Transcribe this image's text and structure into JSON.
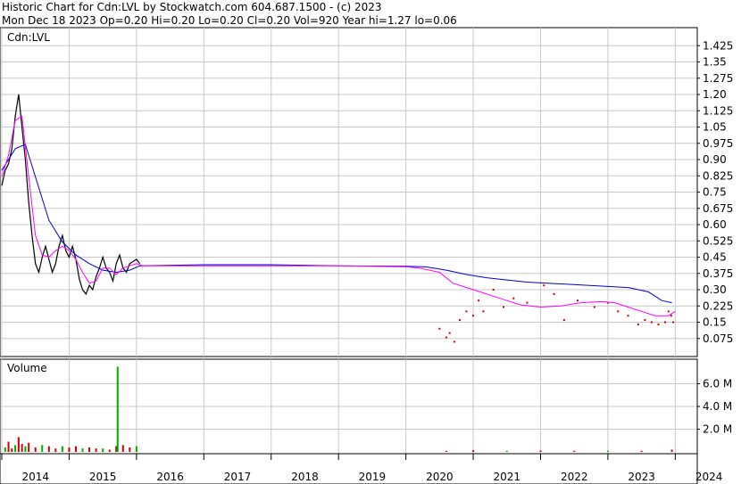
{
  "header": {
    "line1": "Historic Chart for Cdn:LVL by Stockwatch.com 604.687.1500 - (c) 2023",
    "line2": "Mon Dec 18 2023   Op=0.20  Hi=0.20  Lo=0.20  Cl=0.20  Vol=920  Year hi=1.27  lo=0.06"
  },
  "colors": {
    "grid": "#c8c8c8",
    "price_bar": "#000000",
    "ma_short": "#ff00ff",
    "ma_long": "#0000cc",
    "vol_up": "#00aa00",
    "vol_down": "#cc0000",
    "dot_color": "#cc0000"
  },
  "chart_data": [
    {
      "type": "line",
      "title": "Cdn:LVL",
      "ylim": [
        0,
        1.5
      ],
      "yticks": [
        "1.425",
        "1.35",
        "1.275",
        "1.20",
        "1.125",
        "1.05",
        "0.975",
        "0.90",
        "0.825",
        "0.75",
        "0.675",
        "0.60",
        "0.525",
        "0.45",
        "0.375",
        "0.30",
        "0.225",
        "0.15",
        "0.075"
      ],
      "ytick_values": [
        1.425,
        1.35,
        1.275,
        1.2,
        1.125,
        1.05,
        0.975,
        0.9,
        0.825,
        0.75,
        0.675,
        0.6,
        0.525,
        0.45,
        0.375,
        0.3,
        0.225,
        0.15,
        0.075
      ],
      "xlim": [
        2014.0,
        2024.3
      ],
      "xticks": [
        "2014",
        "2015",
        "2016",
        "2017",
        "2018",
        "2019",
        "2020",
        "2021",
        "2022",
        "2023",
        "2024"
      ],
      "xtick_values": [
        2014,
        2015,
        2016,
        2017,
        2018,
        2019,
        2020,
        2021,
        2022,
        2023,
        2024
      ],
      "series": [
        {
          "kind": "close",
          "x": [
            2014.0,
            2014.05,
            2014.1,
            2014.15,
            2014.2,
            2014.25,
            2014.3,
            2014.35,
            2014.4,
            2014.45,
            2014.5,
            2014.55,
            2014.6,
            2014.65,
            2014.7,
            2014.75,
            2014.8,
            2014.85,
            2014.9,
            2014.95,
            2015.0,
            2015.05,
            2015.1,
            2015.15,
            2015.2,
            2015.25,
            2015.3,
            2015.35,
            2015.4,
            2015.45,
            2015.5,
            2015.55,
            2015.6,
            2015.65,
            2015.7,
            2015.75,
            2015.8,
            2015.85,
            2015.9,
            2015.95,
            2016.0,
            2016.05
          ],
          "y": [
            0.78,
            0.85,
            0.88,
            0.95,
            1.1,
            1.2,
            1.05,
            0.9,
            0.7,
            0.55,
            0.42,
            0.38,
            0.45,
            0.5,
            0.44,
            0.38,
            0.42,
            0.5,
            0.55,
            0.48,
            0.45,
            0.5,
            0.44,
            0.35,
            0.3,
            0.28,
            0.32,
            0.3,
            0.36,
            0.4,
            0.45,
            0.4,
            0.38,
            0.34,
            0.42,
            0.46,
            0.4,
            0.38,
            0.42,
            0.43,
            0.44,
            0.42
          ]
        },
        {
          "kind": "dots",
          "x": [
            2020.5,
            2020.6,
            2020.65,
            2020.72,
            2020.8,
            2020.9,
            2021.0,
            2021.08,
            2021.15,
            2021.3,
            2021.45,
            2021.6,
            2021.8,
            2022.05,
            2022.2,
            2022.35,
            2022.55,
            2022.8,
            2023.0,
            2023.15,
            2023.3,
            2023.45,
            2023.55,
            2023.65,
            2023.75,
            2023.85,
            2023.9,
            2023.94,
            2023.97
          ],
          "y": [
            0.12,
            0.08,
            0.1,
            0.06,
            0.16,
            0.2,
            0.18,
            0.25,
            0.2,
            0.3,
            0.22,
            0.26,
            0.24,
            0.32,
            0.28,
            0.16,
            0.25,
            0.22,
            0.24,
            0.2,
            0.18,
            0.14,
            0.16,
            0.15,
            0.14,
            0.15,
            0.2,
            0.18,
            0.15
          ]
        }
      ],
      "ma_short": {
        "name": "",
        "x": [
          2014.0,
          2014.1,
          2014.2,
          2014.3,
          2014.4,
          2014.5,
          2014.6,
          2014.7,
          2014.8,
          2014.9,
          2015.0,
          2015.1,
          2015.2,
          2015.3,
          2015.4,
          2015.5,
          2015.6,
          2015.7,
          2015.8,
          2015.9,
          2016.0,
          2016.1,
          2017.0,
          2018.0,
          2019.0,
          2020.0,
          2020.2,
          2020.5,
          2020.7,
          2020.9,
          2021.1,
          2021.3,
          2021.5,
          2021.7,
          2022.0,
          2022.3,
          2022.6,
          2022.9,
          2023.1,
          2023.3,
          2023.5,
          2023.7,
          2023.9,
          2024.0
        ],
        "y": [
          0.82,
          0.92,
          1.08,
          1.1,
          0.82,
          0.55,
          0.46,
          0.45,
          0.48,
          0.5,
          0.48,
          0.44,
          0.38,
          0.33,
          0.34,
          0.4,
          0.4,
          0.37,
          0.4,
          0.41,
          0.42,
          0.41,
          0.41,
          0.41,
          0.41,
          0.405,
          0.4,
          0.38,
          0.33,
          0.31,
          0.29,
          0.27,
          0.25,
          0.23,
          0.22,
          0.225,
          0.24,
          0.245,
          0.24,
          0.22,
          0.2,
          0.18,
          0.18,
          0.2
        ]
      },
      "ma_long": {
        "name": "",
        "x": [
          2014.0,
          2014.2,
          2014.35,
          2014.5,
          2014.7,
          2014.9,
          2015.1,
          2015.3,
          2015.5,
          2015.7,
          2015.9,
          2016.05,
          2017.0,
          2018.0,
          2019.0,
          2020.0,
          2020.3,
          2020.6,
          2020.9,
          2021.2,
          2021.5,
          2021.8,
          2022.1,
          2022.4,
          2022.7,
          2023.0,
          2023.3,
          2023.6,
          2023.8,
          2023.95
        ],
        "y": [
          0.85,
          0.95,
          0.97,
          0.82,
          0.62,
          0.52,
          0.46,
          0.42,
          0.39,
          0.38,
          0.39,
          0.41,
          0.415,
          0.415,
          0.41,
          0.408,
          0.405,
          0.39,
          0.37,
          0.355,
          0.345,
          0.335,
          0.33,
          0.325,
          0.32,
          0.315,
          0.31,
          0.29,
          0.25,
          0.24
        ]
      }
    },
    {
      "type": "bar",
      "title": "Volume",
      "ylim": [
        0,
        8000000
      ],
      "yticks": [
        "6.0 M",
        "4.0 M",
        "2.0 M"
      ],
      "ytick_values": [
        6000000,
        4000000,
        2000000
      ],
      "series": [
        {
          "name": "",
          "x": [
            2014.05,
            2014.1,
            2014.15,
            2014.2,
            2014.25,
            2014.3,
            2014.35,
            2014.4,
            2014.5,
            2014.6,
            2014.7,
            2014.8,
            2014.9,
            2015.0,
            2015.1,
            2015.2,
            2015.3,
            2015.4,
            2015.5,
            2015.6,
            2015.7,
            2015.72,
            2015.8,
            2015.9,
            2016.0,
            2020.6,
            2021.0,
            2021.5,
            2022.0,
            2022.5,
            2023.0,
            2023.5,
            2023.95
          ],
          "values": [
            400000,
            900000,
            300000,
            600000,
            1300000,
            700000,
            500000,
            800000,
            400000,
            600000,
            500000,
            300000,
            500000,
            400000,
            500000,
            300000,
            400000,
            300000,
            300000,
            200000,
            500000,
            7500000,
            600000,
            400000,
            500000,
            100000,
            150000,
            100000,
            120000,
            100000,
            100000,
            100000,
            200000
          ]
        }
      ]
    }
  ]
}
